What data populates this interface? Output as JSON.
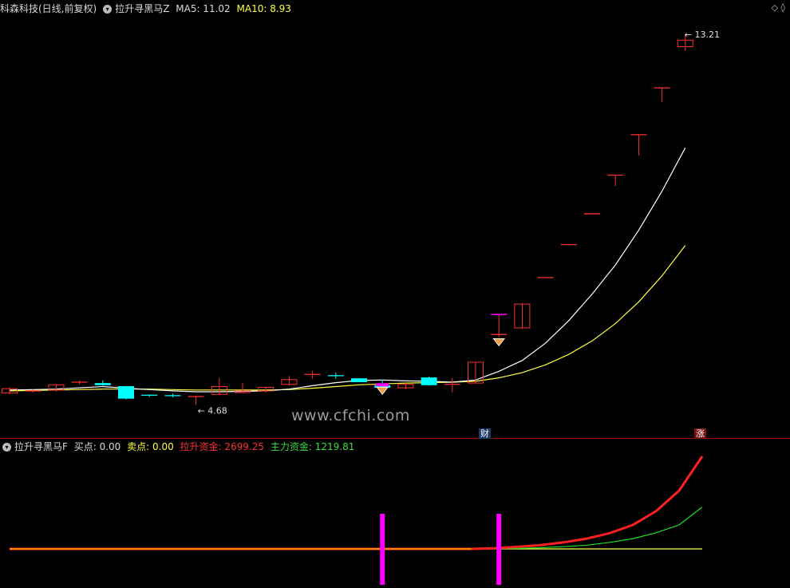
{
  "main_header": {
    "stock_name": "科森科技(日线,前复权)",
    "indicator_name": "拉升寻黑马Z",
    "ma5_label": "MA5: 11.02",
    "ma10_label": "MA10: 8.93"
  },
  "sub_header": {
    "indicator_name": "拉升寻黑马F",
    "buy_label": "买点: 0.00",
    "sell_label": "卖点: 0.00",
    "lift_fund_label": "拉升资金: 2699.25",
    "main_fund_label": "主力资金: 1219.81"
  },
  "annotations": {
    "high_price": "13.21",
    "low_price": "4.68",
    "badge_finance": "财",
    "badge_rise": "涨",
    "watermark": "www.cfchi.com",
    "corner_icons": "◇ ◊"
  },
  "colors": {
    "bull": "#ff3030",
    "bear": "#00ffff",
    "ma5": "#ffffff",
    "ma10": "#ffff3c",
    "lift_fund": "#ff2020",
    "main_fund": "#20e020",
    "buy_bar": "#ff00ff",
    "divider": "#b00000"
  },
  "chart_data": [
    {
      "type": "candlestick",
      "title": "拉升寻黑马Z",
      "ylim": [
        4.3,
        13.6
      ],
      "candles": [
        {
          "o": 4.95,
          "c": 5.05,
          "h": 5.08,
          "l": 4.92
        },
        {
          "o": 4.98,
          "c": 5.0,
          "h": 5.03,
          "l": 4.96
        },
        {
          "o": 5.02,
          "c": 5.14,
          "h": 5.16,
          "l": 4.98
        },
        {
          "o": 5.18,
          "c": 5.2,
          "h": 5.24,
          "l": 5.15
        },
        {
          "o": 5.17,
          "c": 5.14,
          "h": 5.24,
          "l": 5.12
        },
        {
          "o": 5.1,
          "c": 4.83,
          "h": 5.1,
          "l": 4.8
        },
        {
          "o": 4.9,
          "c": 4.88,
          "h": 4.92,
          "l": 4.86
        },
        {
          "o": 4.89,
          "c": 4.88,
          "h": 4.94,
          "l": 4.85
        },
        {
          "o": 4.86,
          "c": 4.87,
          "h": 4.89,
          "l": 4.68
        },
        {
          "o": 4.92,
          "c": 5.1,
          "h": 5.3,
          "l": 4.9
        },
        {
          "o": 4.96,
          "c": 5.0,
          "h": 5.18,
          "l": 4.95
        },
        {
          "o": 5.0,
          "c": 5.08,
          "h": 5.1,
          "l": 4.96
        },
        {
          "o": 5.15,
          "c": 5.26,
          "h": 5.34,
          "l": 5.12
        },
        {
          "o": 5.38,
          "c": 5.38,
          "h": 5.46,
          "l": 5.28
        },
        {
          "o": 5.35,
          "c": 5.34,
          "h": 5.42,
          "l": 5.28
        },
        {
          "o": 5.28,
          "c": 5.21,
          "h": 5.3,
          "l": 5.2
        },
        {
          "o": 5.12,
          "c": 5.08,
          "h": 5.26,
          "l": 5.02
        },
        {
          "o": 5.07,
          "c": 5.15,
          "h": 5.18,
          "l": 5.04
        },
        {
          "o": 5.3,
          "c": 5.14,
          "h": 5.33,
          "l": 5.12
        },
        {
          "o": 5.14,
          "c": 5.15,
          "h": 5.29,
          "l": 4.97
        },
        {
          "o": 5.18,
          "c": 5.66,
          "h": 5.66,
          "l": 5.18
        },
        {
          "o": 6.3,
          "c": 6.3,
          "h": 6.76,
          "l": 6.24
        },
        {
          "o": 6.45,
          "c": 7.0,
          "h": 7.0,
          "l": 6.45
        },
        {
          "o": 7.61,
          "c": 7.61,
          "h": 7.61,
          "l": 7.61
        },
        {
          "o": 8.35,
          "c": 8.37,
          "h": 8.37,
          "l": 8.35
        },
        {
          "o": 9.08,
          "c": 9.08,
          "h": 9.08,
          "l": 9.08
        },
        {
          "o": 9.97,
          "c": 9.97,
          "h": 9.97,
          "l": 9.72
        },
        {
          "o": 10.9,
          "c": 10.9,
          "h": 10.9,
          "l": 10.42
        },
        {
          "o": 11.98,
          "c": 11.98,
          "h": 11.98,
          "l": 11.66
        },
        {
          "o": 12.93,
          "c": 13.08,
          "h": 13.21,
          "l": 12.82
        }
      ],
      "ma5": [
        5.02,
        5.03,
        5.04,
        5.07,
        5.1,
        5.06,
        5.03,
        5.0,
        4.98,
        4.98,
        4.99,
        5.0,
        5.04,
        5.12,
        5.19,
        5.24,
        5.25,
        5.23,
        5.22,
        5.2,
        5.25,
        5.45,
        5.7,
        6.1,
        6.62,
        7.23,
        7.9,
        8.7,
        9.6,
        10.6
      ],
      "ma10": [
        5.0,
        5.01,
        5.02,
        5.03,
        5.04,
        5.04,
        5.04,
        5.03,
        5.02,
        5.02,
        5.02,
        5.02,
        5.03,
        5.06,
        5.1,
        5.14,
        5.16,
        5.18,
        5.19,
        5.2,
        5.22,
        5.3,
        5.42,
        5.6,
        5.84,
        6.15,
        6.55,
        7.05,
        7.65,
        8.35
      ]
    },
    {
      "type": "line",
      "title": "拉升寻黑马F",
      "series": [
        {
          "name": "拉升资金",
          "values": [
            0,
            0,
            0,
            0,
            0,
            0,
            0,
            0,
            0,
            0,
            0,
            0,
            0,
            0,
            0,
            0,
            0,
            0,
            0,
            0,
            0,
            20,
            60,
            110,
            190,
            300,
            460,
            700,
            1100,
            1700,
            2699.25
          ]
        },
        {
          "name": "主力资金",
          "values": [
            0,
            0,
            0,
            0,
            0,
            0,
            0,
            0,
            0,
            0,
            0,
            0,
            0,
            0,
            0,
            0,
            0,
            0,
            0,
            0,
            0,
            5,
            15,
            35,
            65,
            110,
            190,
            300,
            470,
            700,
            1219.81
          ]
        },
        {
          "name": "卖点",
          "values": [
            0,
            0,
            0,
            0,
            0,
            0,
            0,
            0,
            0,
            0,
            0,
            0,
            0,
            0,
            0,
            0,
            0,
            0,
            0,
            0,
            0,
            0,
            0,
            0,
            0,
            0,
            0,
            0,
            0,
            0,
            0
          ]
        }
      ],
      "buy_signals": [
        16,
        21
      ],
      "buy_value": 0.0,
      "sell_value": 0.0
    }
  ]
}
